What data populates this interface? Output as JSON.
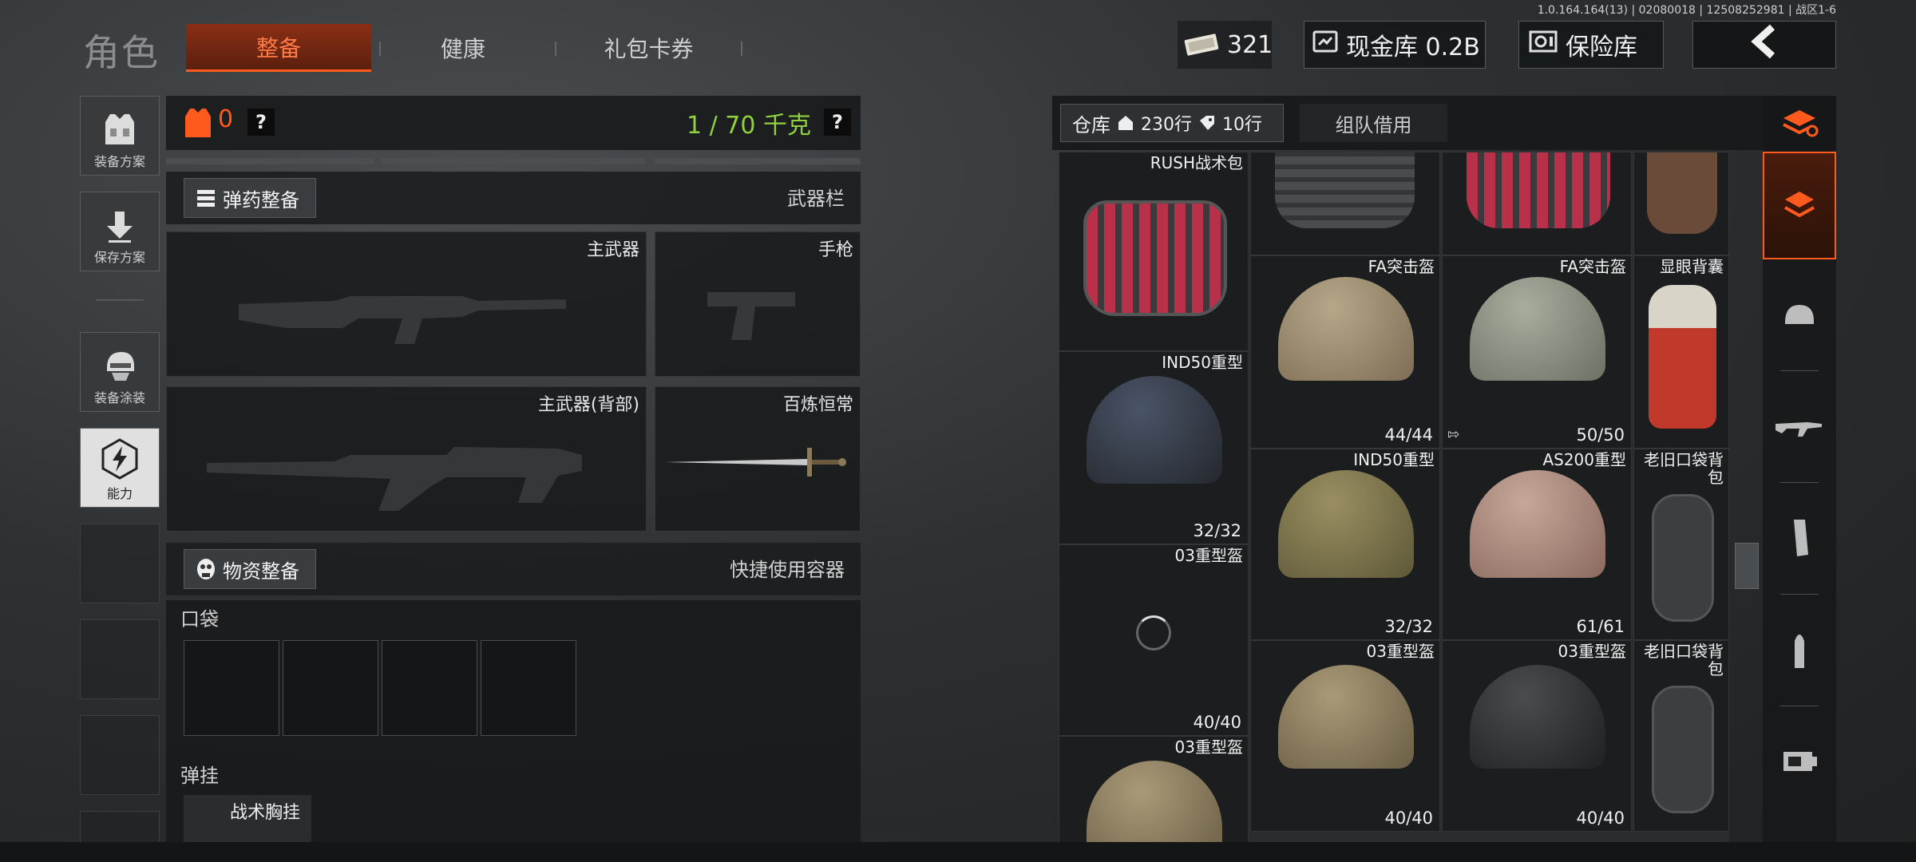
{
  "version": "1.0.164.164(13) | 02080018 | 12508252981 | 战区1-6",
  "header": {
    "title": "角色",
    "tabs": [
      {
        "label": "整备",
        "active": true
      },
      {
        "label": "健康",
        "active": false
      },
      {
        "label": "礼包卡券",
        "active": false
      }
    ],
    "cash_value": "321",
    "vault_label": "现金库 0.2B",
    "insurance_label": "保险库"
  },
  "sidebar": {
    "items": [
      {
        "label": "装备方案",
        "icon": "vest-icon"
      },
      {
        "label": "保存方案",
        "icon": "download-icon"
      },
      {
        "label": "装备涂装",
        "icon": "helmet-paint-icon"
      },
      {
        "label": "能力",
        "icon": "lightning-icon"
      }
    ]
  },
  "equipment": {
    "armor_count": "0",
    "help_glyph": "?",
    "weight": "1 / 70 千克",
    "ammo_section": {
      "button": "弹药整备",
      "right_label": "武器栏"
    },
    "slots": {
      "primary": "主武器",
      "pistol": "手枪",
      "primary_back": "主武器(背部)",
      "melee": "百炼恒常"
    },
    "supply_section": {
      "button": "物资整备",
      "right_label": "快捷使用容器"
    },
    "pocket_label": "口袋",
    "rig_label": "弹挂",
    "rig_item": "战术胸挂"
  },
  "warehouse": {
    "tab_label": "仓库",
    "house_rows": "230行",
    "tag_rows": "10行",
    "team_tab": "组队借用",
    "items": [
      {
        "id": "c1",
        "name": "RUSH战术包",
        "durability": ""
      },
      {
        "id": "c2",
        "name": "",
        "durability": ""
      },
      {
        "id": "c3",
        "name": "",
        "durability": ""
      },
      {
        "id": "c4",
        "name": "",
        "durability": ""
      },
      {
        "id": "c5",
        "name": "FA突击盔",
        "durability": "44/44"
      },
      {
        "id": "c6",
        "name": "FA突击盔",
        "durability": "50/50"
      },
      {
        "id": "c7",
        "name": "显眼背囊",
        "durability": ""
      },
      {
        "id": "c8",
        "name": "IND50重型",
        "durability": "32/32"
      },
      {
        "id": "c9",
        "name": "IND50重型",
        "durability": "32/32"
      },
      {
        "id": "c10",
        "name": "AS200重型",
        "durability": "61/61"
      },
      {
        "id": "c11",
        "name": "老旧口袋背包",
        "durability": ""
      },
      {
        "id": "c12",
        "name": "03重型盔",
        "durability": "40/40"
      },
      {
        "id": "c13",
        "name": "03重型盔",
        "durability": "40/40"
      },
      {
        "id": "c14",
        "name": "03重型盔",
        "durability": "40/40"
      },
      {
        "id": "c15",
        "name": "老旧口袋背包",
        "durability": ""
      },
      {
        "id": "c16",
        "name": "03重型盔",
        "durability": ""
      }
    ]
  },
  "filters": [
    "all-stack-icon",
    "layers-icon",
    "helmet-icon",
    "rifle-icon",
    "magazine-icon",
    "bullet-icon",
    "sight-icon"
  ],
  "colors": {
    "accent": "#ff5a1e",
    "weight_green": "#8fd13f",
    "bg": "#2e3133"
  }
}
